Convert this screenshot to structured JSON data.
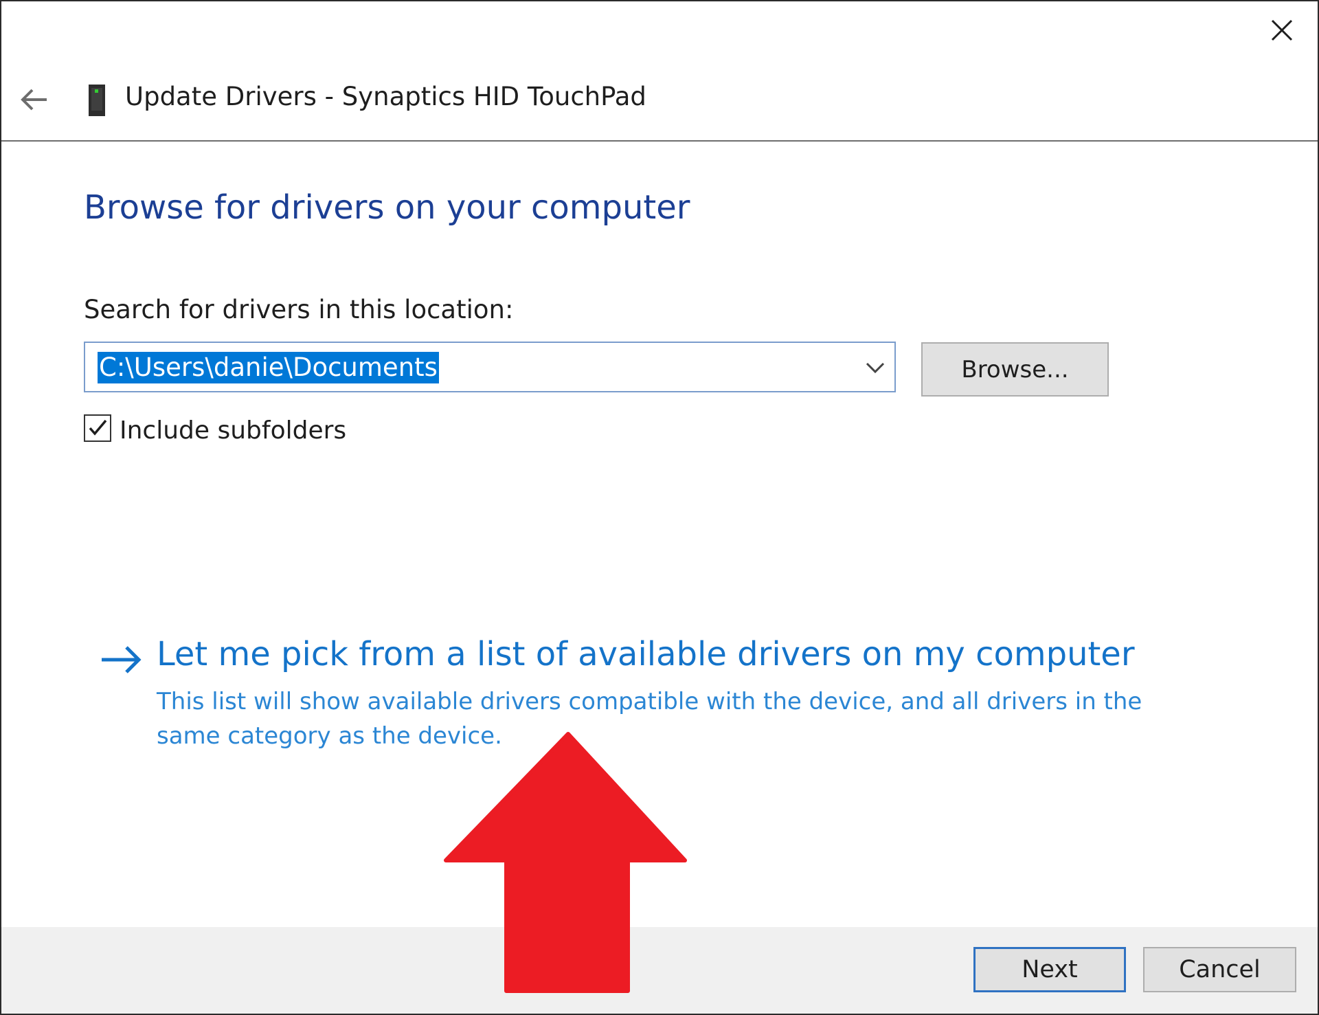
{
  "window": {
    "title": "Update Drivers - Synaptics HID TouchPad"
  },
  "main": {
    "heading": "Browse for drivers on your computer",
    "location_label": "Search for drivers in this location:",
    "location_value": "C:\\Users\\danie\\Documents",
    "browse_label": "Browse...",
    "include_subfolders_label": "Include subfolders",
    "include_subfolders_checked": true
  },
  "pick_option": {
    "title": "Let me pick from a list of available drivers on my computer",
    "description": "This list will show available drivers compatible with the device, and all drivers in the same category as the device."
  },
  "footer": {
    "next_label": "Next",
    "cancel_label": "Cancel"
  },
  "colors": {
    "heading": "#1c3f94",
    "link": "#1473c9",
    "selection": "#0078d7",
    "annotation_arrow": "#ec1c24"
  },
  "icons": [
    "close-icon",
    "back-arrow-icon",
    "touchpad-device-icon",
    "chevron-down-icon",
    "checkmark-icon",
    "right-arrow-icon",
    "red-up-arrow-annotation"
  ]
}
